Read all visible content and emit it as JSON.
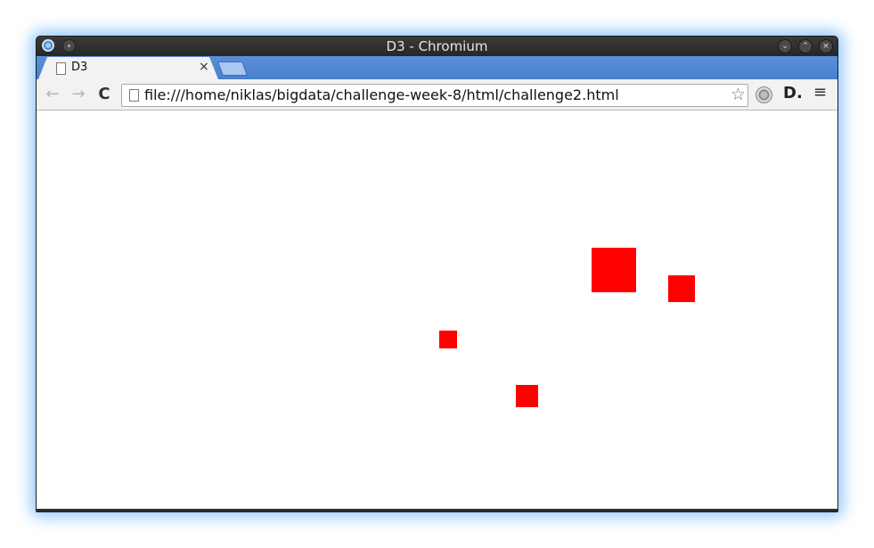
{
  "window": {
    "title": "D3 - Chromium"
  },
  "tabs": [
    {
      "label": "D3",
      "close": "×"
    }
  ],
  "toolbar": {
    "back_glyph": "←",
    "forward_glyph": "→",
    "reload_glyph": "C",
    "url": "file:///home/niklas/bigdata/challenge-week-8/html/challenge2.html",
    "bookmark_glyph": "☆",
    "ext_d_glyph": "D.",
    "menu_glyph": "≡"
  },
  "window_buttons": {
    "minimize": "⌄",
    "maximize": "⌃",
    "close": "×"
  },
  "content": {
    "fill_color": "#ff0000"
  }
}
